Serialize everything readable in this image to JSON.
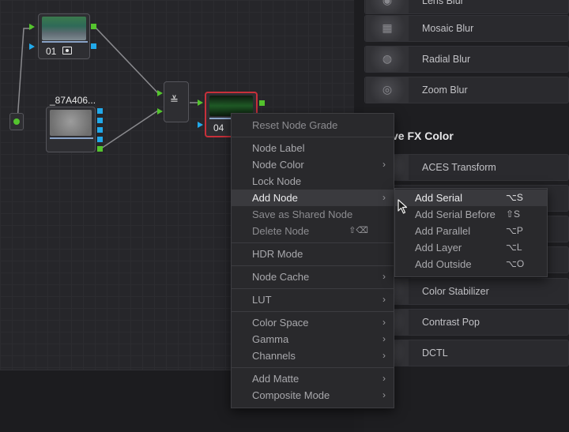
{
  "graph": {
    "node1": {
      "label": "01",
      "badge_icon": "camera-icon"
    },
    "node2": {
      "label": "_87A406..."
    },
    "node4": {
      "label": "04"
    },
    "mixer_icon": "parallel-mixer-icon"
  },
  "fx_panel": {
    "items_top": [
      {
        "label": "Lens Blur",
        "icon": "blur-icon"
      },
      {
        "label": "Mosaic Blur",
        "icon": "mosaic-icon"
      },
      {
        "label": "Radial Blur",
        "icon": "radial-blur-icon"
      },
      {
        "label": "Zoom Blur",
        "icon": "zoom-blur-icon"
      }
    ],
    "section_title": "ve FX Color",
    "items_bottom": [
      {
        "label": "ACES Transform",
        "icon": "aces-icon"
      },
      {
        "label": "Color Stabilizer",
        "icon": "stabilizer-icon"
      },
      {
        "label": "Contrast Pop",
        "icon": "contrast-icon"
      },
      {
        "label": "DCTL",
        "icon": "dctl-icon"
      }
    ]
  },
  "context_menu": {
    "items": [
      {
        "label": "Reset Node Grade"
      },
      {
        "label": "Node Label"
      },
      {
        "label": "Node Color",
        "arrow": "›"
      },
      {
        "label": "Lock Node"
      },
      {
        "label": "Add Node",
        "arrow": "›"
      },
      {
        "label": "Save as Shared Node"
      },
      {
        "label": "Delete Node",
        "shortcut": "⇧⌫"
      },
      {
        "label": "HDR Mode"
      },
      {
        "label": "Node Cache",
        "arrow": "›"
      },
      {
        "label": "LUT",
        "arrow": "›"
      },
      {
        "label": "Color Space",
        "arrow": "›"
      },
      {
        "label": "Gamma",
        "arrow": "›"
      },
      {
        "label": "Channels",
        "arrow": "›"
      },
      {
        "label": "Add Matte",
        "arrow": "›"
      },
      {
        "label": "Composite Mode",
        "arrow": "›"
      }
    ]
  },
  "submenu": {
    "items": [
      {
        "label": "Add Serial",
        "shortcut": "⌥S"
      },
      {
        "label": "Add Serial Before",
        "shortcut": "⇧S"
      },
      {
        "label": "Add Parallel",
        "shortcut": "⌥P"
      },
      {
        "label": "Add Layer",
        "shortcut": "⌥L"
      },
      {
        "label": "Add Outside",
        "shortcut": "⌥O"
      }
    ]
  },
  "colors": {
    "port_green": "#54c42e",
    "port_blue": "#21a9ea",
    "selected_border": "#c8303a"
  }
}
